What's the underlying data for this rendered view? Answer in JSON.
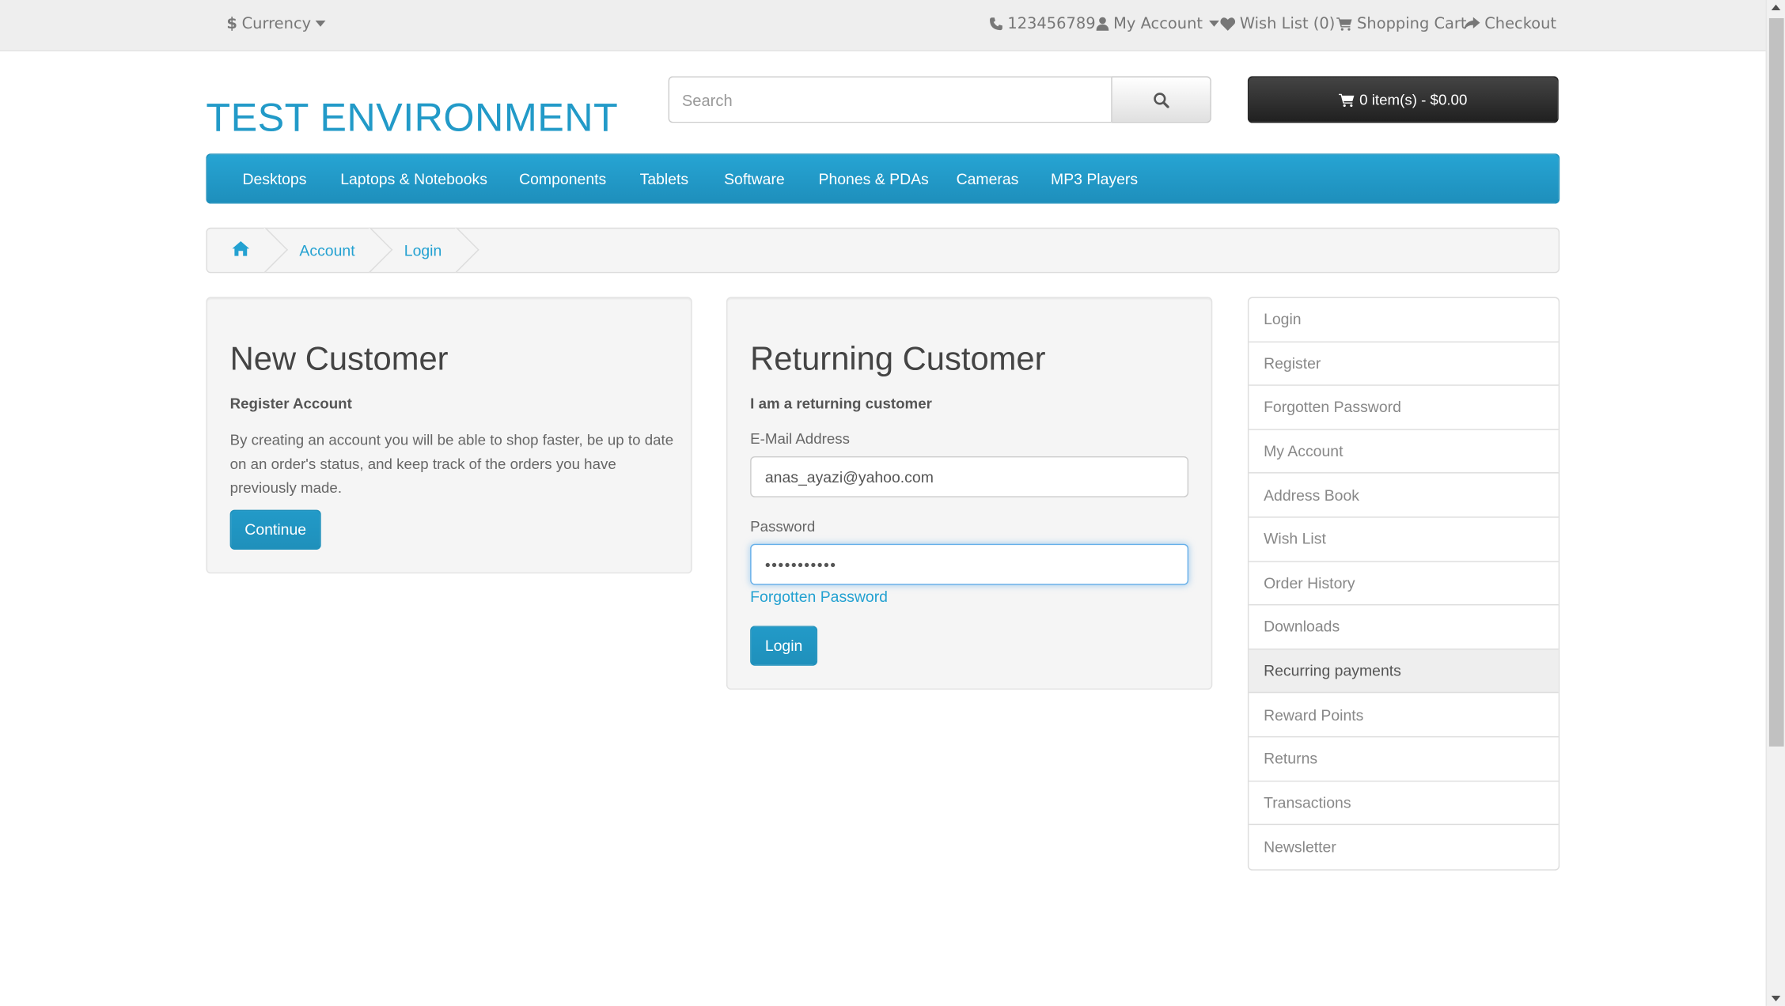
{
  "topbar": {
    "currency_label": "Currency",
    "phone": "123456789",
    "my_account": "My Account",
    "wish_list": "Wish List (0)",
    "shopping_cart": "Shopping Cart",
    "checkout": "Checkout"
  },
  "header": {
    "logo_text": "TEST ENVIRONMENT",
    "search_placeholder": "Search",
    "cart_button": "0 item(s) - $0.00"
  },
  "menu": [
    "Desktops",
    "Laptops & Notebooks",
    "Components",
    "Tablets",
    "Software",
    "Phones & PDAs",
    "Cameras",
    "MP3 Players"
  ],
  "breadcrumb": [
    "Account",
    "Login"
  ],
  "new_customer": {
    "title": "New Customer",
    "subtitle": "Register Account",
    "description": "By creating an account you will be able to shop faster, be up to date on an order's status, and keep track of the orders you have previously made.",
    "button": "Continue"
  },
  "returning_customer": {
    "title": "Returning Customer",
    "subtitle": "I am a returning customer",
    "email_label": "E-Mail Address",
    "email_value": "anas_ayazi@yahoo.com",
    "password_label": "Password",
    "password_value": "•••••••••••",
    "forgotten_link": "Forgotten Password",
    "button": "Login"
  },
  "account_list": [
    "Login",
    "Register",
    "Forgotten Password",
    "My Account",
    "Address Book",
    "Wish List",
    "Order History",
    "Downloads",
    "Recurring payments",
    "Reward Points",
    "Returns",
    "Transactions",
    "Newsletter"
  ],
  "colors": {
    "accent": "#229ac8",
    "link": "#23a1d1",
    "cart_bg": "#303030"
  },
  "icons": [
    "dollar-icon",
    "caret-down-icon",
    "phone-icon",
    "user-icon",
    "heart-icon",
    "cart-icon",
    "share-icon",
    "search-icon",
    "home-icon"
  ]
}
